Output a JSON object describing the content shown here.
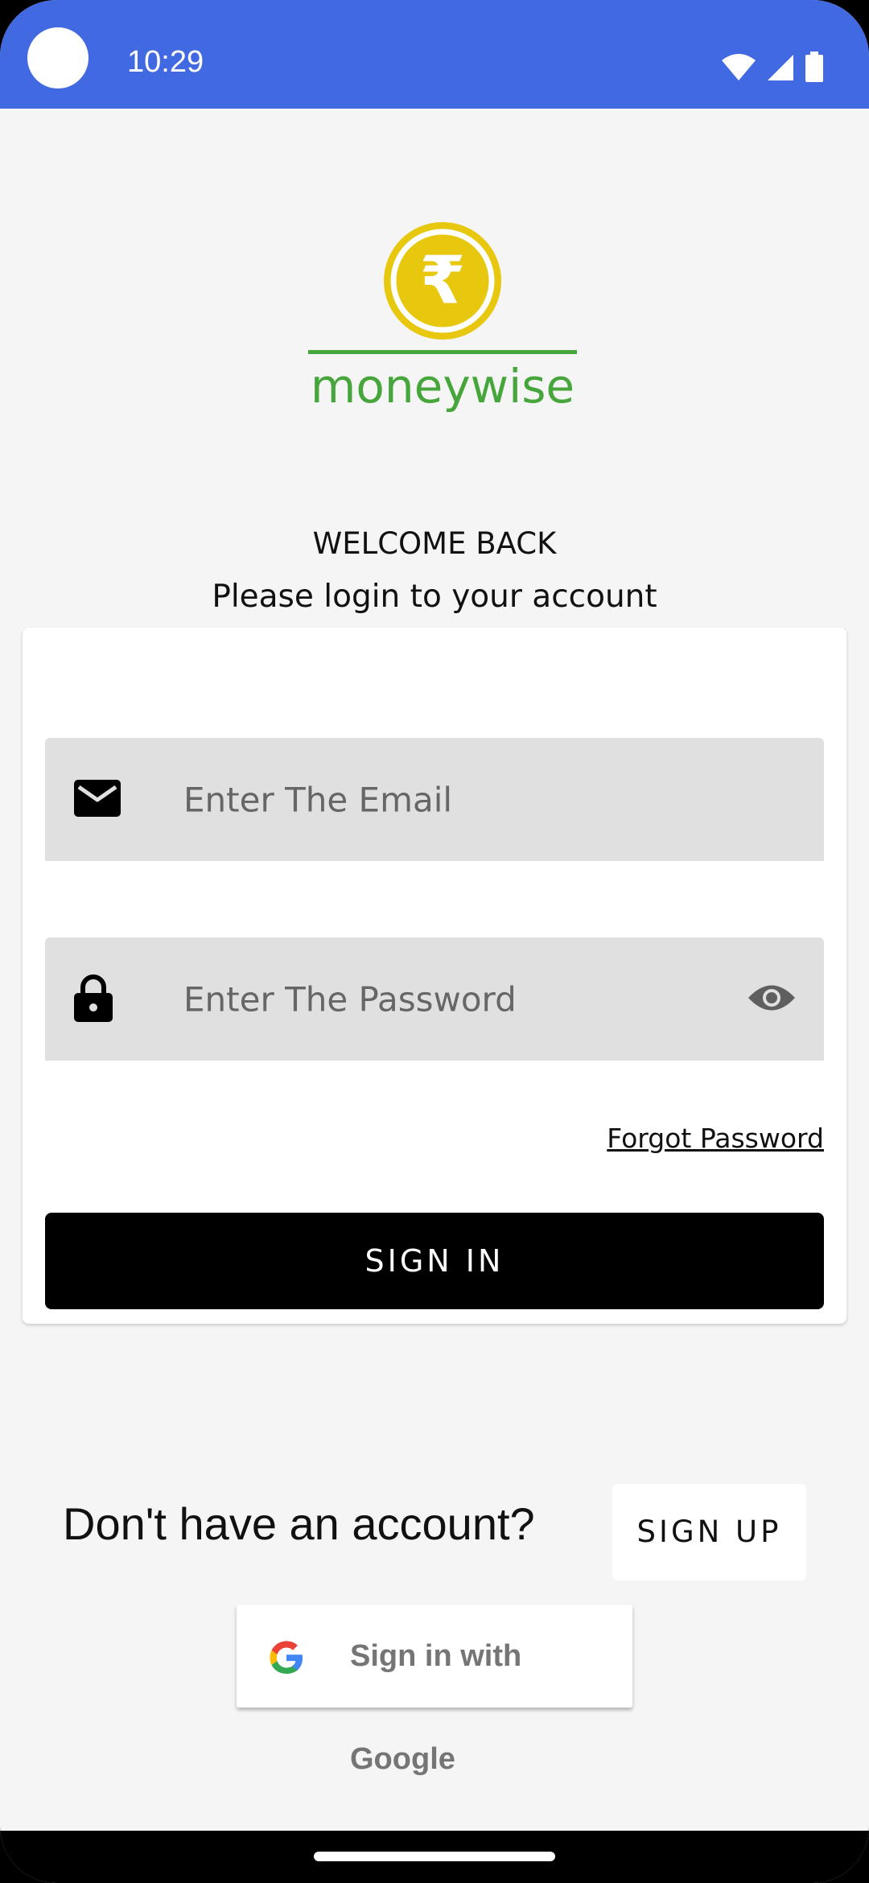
{
  "status_bar": {
    "time": "10:29",
    "icons": [
      "wifi-icon",
      "cellular-signal-icon",
      "battery-icon"
    ]
  },
  "logo": {
    "name": "moneywise",
    "symbol": "₹",
    "colors": {
      "coin": "#e8c70f",
      "text": "#46a63c"
    }
  },
  "header": {
    "welcome": "WELCOME BACK",
    "subtitle": "Please login to your account"
  },
  "form": {
    "email": {
      "placeholder": "Enter The Email",
      "value": "",
      "icon": "mail-icon"
    },
    "password": {
      "placeholder": "Enter The Password",
      "value": "",
      "icon": "lock-icon",
      "toggle_icon": "eye-icon"
    },
    "forgot_label": "Forgot Password",
    "signin_label": "SIGN IN"
  },
  "footer": {
    "no_account_text": "Don't have an account?",
    "signup_label": "SIGN UP",
    "google_label": "Sign in with Google"
  },
  "colors": {
    "status_bar": "#4169e1",
    "background": "#f5f5f5",
    "field": "#e0e0e0",
    "primary_button": "#000000"
  }
}
